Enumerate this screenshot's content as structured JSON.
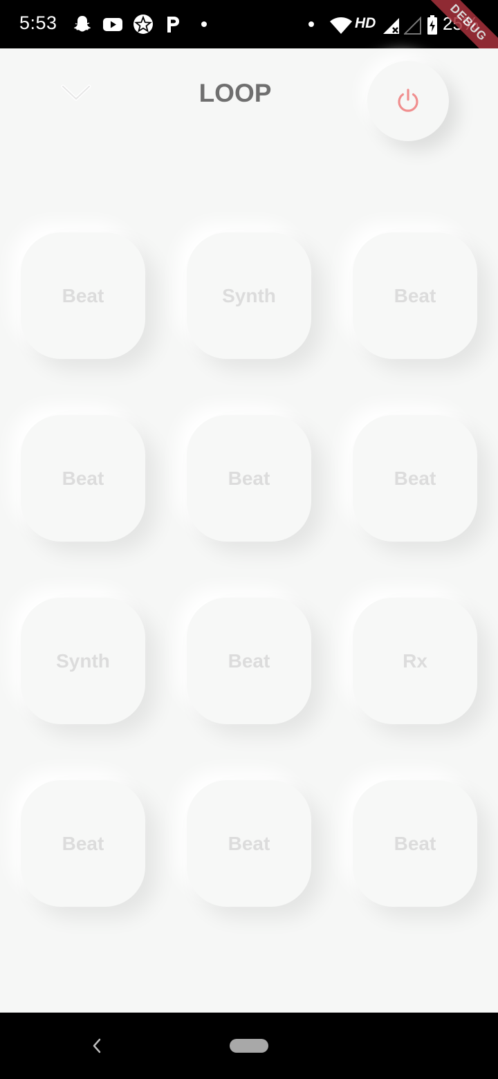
{
  "status_bar": {
    "time": "5:53",
    "hd": "HD",
    "battery": "25%",
    "debug_banner": "DEBUG",
    "icons": [
      "snapchat-icon",
      "youtube-icon",
      "pokerstars-icon",
      "paypal-icon",
      "wifi-icon",
      "signal-icon",
      "signal-empty-icon",
      "battery-charging-icon"
    ]
  },
  "header": {
    "title": "LOOP",
    "collapse_icon": "chevron-down-icon",
    "power_icon": "power-icon",
    "power_color": "#f08e8e"
  },
  "pads": [
    {
      "label": "Beat"
    },
    {
      "label": "Synth"
    },
    {
      "label": "Beat"
    },
    {
      "label": "Beat"
    },
    {
      "label": "Beat"
    },
    {
      "label": "Beat"
    },
    {
      "label": "Synth"
    },
    {
      "label": "Beat"
    },
    {
      "label": "Rx"
    },
    {
      "label": "Beat"
    },
    {
      "label": "Beat"
    },
    {
      "label": "Beat"
    }
  ],
  "nav_bar": {
    "back_icon": "back-icon",
    "home_icon": "home-pill-icon"
  }
}
